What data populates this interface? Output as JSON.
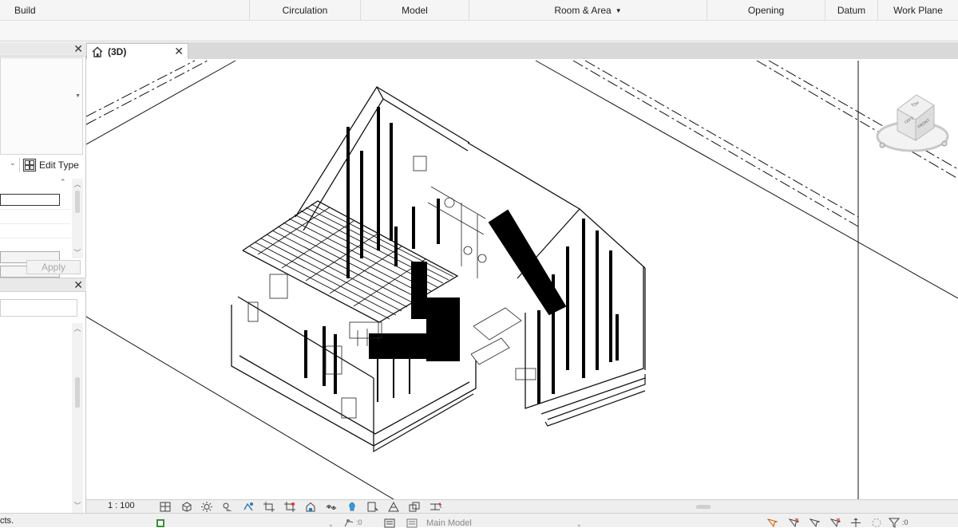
{
  "ribbon": {
    "panels": [
      "Build",
      "Circulation",
      "Model",
      "Room & Area",
      "Opening",
      "Datum",
      "Work Plane"
    ],
    "room_area_dropdown": "chevron-down-icon"
  },
  "properties": {
    "edit_type_label": "Edit Type",
    "apply_label": "Apply"
  },
  "view_tab": {
    "label": "(3D)"
  },
  "view_control": {
    "scale": "1 : 100"
  },
  "status_bar": {
    "left_text": "cts.",
    "workset_count": ":0",
    "model_label": "Main Model",
    "filter_count": ":0"
  },
  "icons": [
    "close-icon",
    "home-icon",
    "edit-type-icon",
    "viewcube-icon",
    "filter-icon"
  ]
}
